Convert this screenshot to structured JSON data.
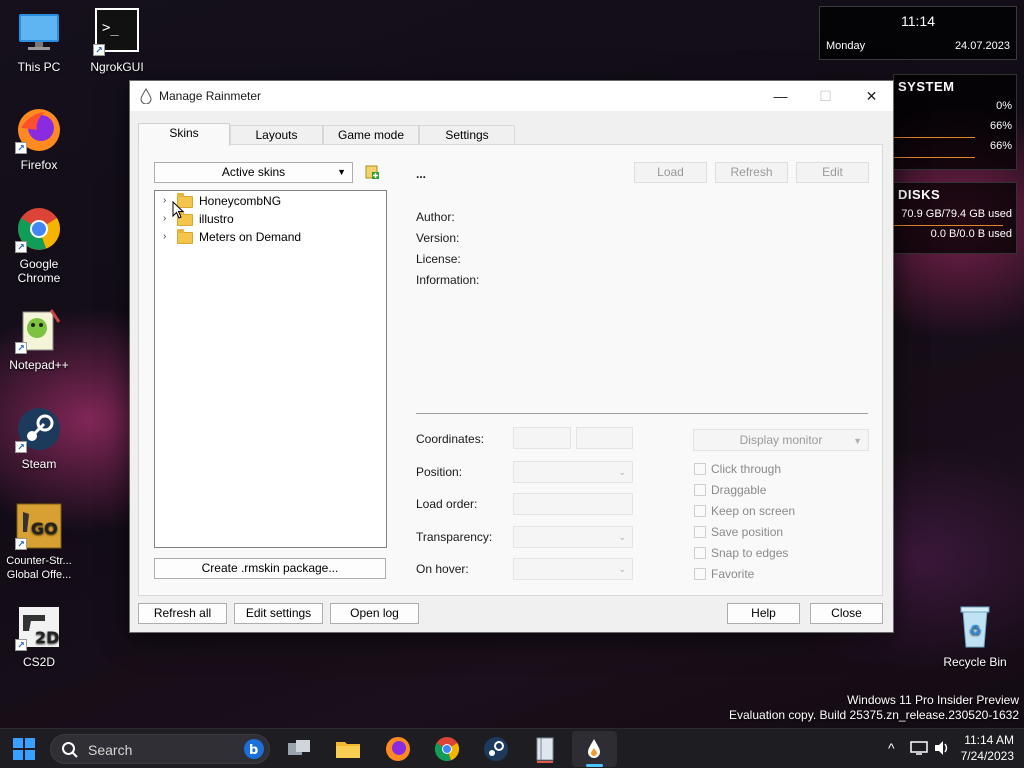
{
  "desktop": {
    "icons": [
      {
        "label": "This PC"
      },
      {
        "label": "NgrokGUI"
      },
      {
        "label": "Firefox"
      },
      {
        "label": "Google Chrome"
      },
      {
        "label": "Notepad++"
      },
      {
        "label": "Steam"
      },
      {
        "label": "Counter-Str... Global Offe..."
      },
      {
        "label": "CS2D"
      },
      {
        "label": "Recycle Bin"
      }
    ]
  },
  "widgets": {
    "clock": {
      "time": "11:14",
      "day": "Monday",
      "date": "24.07.2023"
    },
    "system": {
      "title": "SYSTEM",
      "rows": [
        {
          "value": "0%",
          "level": 0
        },
        {
          "value": "66%",
          "level": 66
        },
        {
          "value": "66%",
          "level": 66
        }
      ]
    },
    "disks": {
      "title": "DISKS",
      "rows": [
        {
          "value": "70.9 GB/79.4 GB used",
          "level": 89
        },
        {
          "value": "0.0 B/0.0 B used",
          "level": 0
        }
      ]
    }
  },
  "window": {
    "title": "Manage Rainmeter",
    "controls": {
      "minimize": "—",
      "maximize": "☐",
      "close": "✕"
    },
    "tabs": [
      {
        "label": "Skins",
        "active": true
      },
      {
        "label": "Layouts",
        "active": false
      },
      {
        "label": "Game mode",
        "active": false
      },
      {
        "label": "Settings",
        "active": false
      }
    ],
    "skins": {
      "dropdown": "Active skins",
      "tree": [
        {
          "label": "HoneycombNG"
        },
        {
          "label": "illustro"
        },
        {
          "label": "Meters on Demand"
        }
      ],
      "create_button": "Create .rmskin package...",
      "selected_name": "...",
      "actions": {
        "load": "Load",
        "refresh": "Refresh",
        "edit": "Edit"
      },
      "info": {
        "author": "Author:",
        "version": "Version:",
        "license": "License:",
        "information": "Information:"
      },
      "settings": {
        "coordinates": "Coordinates:",
        "position": "Position:",
        "load_order": "Load order:",
        "transparency": "Transparency:",
        "on_hover": "On hover:",
        "display_monitor": "Display monitor"
      },
      "checkboxes": {
        "click_through": "Click through",
        "draggable": "Draggable",
        "keep_on_screen": "Keep on screen",
        "save_position": "Save position",
        "snap_to_edges": "Snap to edges",
        "favorite": "Favorite"
      }
    },
    "footer": {
      "refresh_all": "Refresh all",
      "edit_settings": "Edit settings",
      "open_log": "Open log",
      "help": "Help",
      "close": "Close"
    }
  },
  "watermark": {
    "line1": "Windows 11 Pro Insider Preview",
    "line2": "Evaluation copy. Build 25375.zn_release.230520-1632"
  },
  "taskbar": {
    "search_placeholder": "Search",
    "time": "11:14 AM",
    "date": "7/24/2023",
    "tray_overflow": "^"
  }
}
